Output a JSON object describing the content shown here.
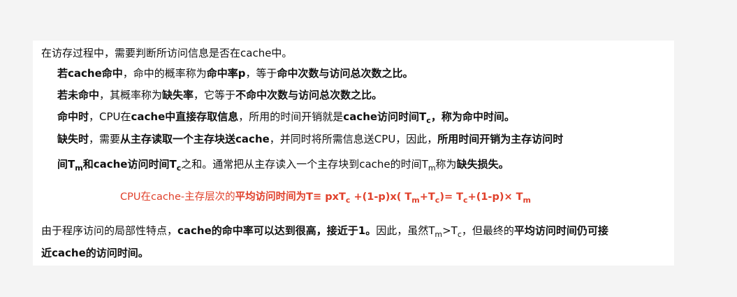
{
  "intro": "在访存过程中，需要判断所访问信息是否在cache中。",
  "hit": {
    "a": "若cache命中",
    "b": "，命中的概率称为",
    "c": "命中率p",
    "d": "，等于",
    "e": "命中次数与访问总次数之比。"
  },
  "miss": {
    "a": "若未命中",
    "b": "，其概率称为",
    "c": "缺失率",
    "d": "，它等于",
    "e": "不命中次数与访问总次数之比。"
  },
  "hit_time": {
    "a": "命中时",
    "b": "，CPU在",
    "c": "cache中直接存取信息",
    "d": "，所用的时间开销就是",
    "e": "cache访问时间T",
    "f": "c",
    "g": "，称为命中时间。"
  },
  "miss_time": {
    "a": "缺失时",
    "b": "，需要",
    "c": "从主存读取一个主存块送cache",
    "d": "，并同时将所需信息送CPU，因此，",
    "e": "所用时间开销为主存访问时",
    "f": "间T",
    "g": "m",
    "h": "和cache访问时间T",
    "i": "c",
    "j": "之和。通常把从主存读入一个主存块到cache的时间T",
    "k": "m",
    "l": "称为",
    "m": "缺失损失。"
  },
  "formula": {
    "a": "CPU在cache-主存层次的",
    "b": "平均访问时间为T≡ pxT",
    "c": "c",
    "d": " +(1-p)x( T",
    "e": "m",
    "f": "+T",
    "g": "c",
    "h": ")= T",
    "i": "c",
    "j": "+(1-p)× T",
    "k": "m"
  },
  "conclusion": {
    "a": "由于程序访问的局部性特点，",
    "b": "cache的命中率可以达到很高，接近于1。",
    "c": "因此，虽然T",
    "d": "m",
    "e": ">T",
    "f": "c",
    "g": "，但最终的",
    "h": "平均访问时间仍可接",
    "i": "近cache的访问时间。"
  },
  "colors": {
    "formula": "#e0402b",
    "text": "#111111",
    "background": "#f4f4f4",
    "slide": "#ffffff"
  }
}
